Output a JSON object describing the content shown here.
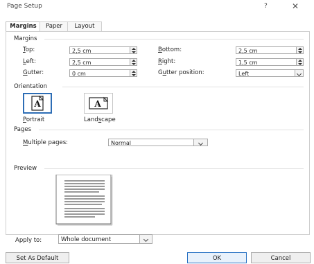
{
  "window": {
    "title": "Page Setup",
    "help": "?",
    "close": "✕"
  },
  "tabs": [
    {
      "label": "Margins",
      "active": true
    },
    {
      "label": "Paper",
      "active": false
    },
    {
      "label": "Layout",
      "active": false
    }
  ],
  "margins": {
    "section": "Margins",
    "top": {
      "label": "Top:",
      "value": "2,5 cm"
    },
    "bottom": {
      "label": "Bottom:",
      "value": "2,5 cm"
    },
    "left": {
      "label": "Left:",
      "value": "2,5 cm"
    },
    "right": {
      "label": "Right:",
      "value": "1,5 cm"
    },
    "gutter": {
      "label": "Gutter:",
      "value": "0 cm"
    },
    "gutter_position": {
      "label": "Gutter position:",
      "value": "Left"
    }
  },
  "orientation": {
    "section": "Orientation",
    "portrait": "Portrait",
    "landscape": "Landscape",
    "selected": "portrait"
  },
  "pages": {
    "section": "Pages",
    "multiple_pages": {
      "label": "Multiple pages:",
      "value": "Normal"
    }
  },
  "preview": {
    "section": "Preview"
  },
  "apply_to": {
    "label": "Apply to:",
    "value": "Whole document"
  },
  "buttons": {
    "set_default": "Set As Default",
    "ok": "OK",
    "cancel": "Cancel"
  },
  "icons": {
    "help": "help-icon",
    "close": "close-icon",
    "spin": "spin-arrows-icon",
    "chevron": "chevron-down-icon",
    "portrait": "portrait-page-icon",
    "landscape": "landscape-page-icon"
  }
}
